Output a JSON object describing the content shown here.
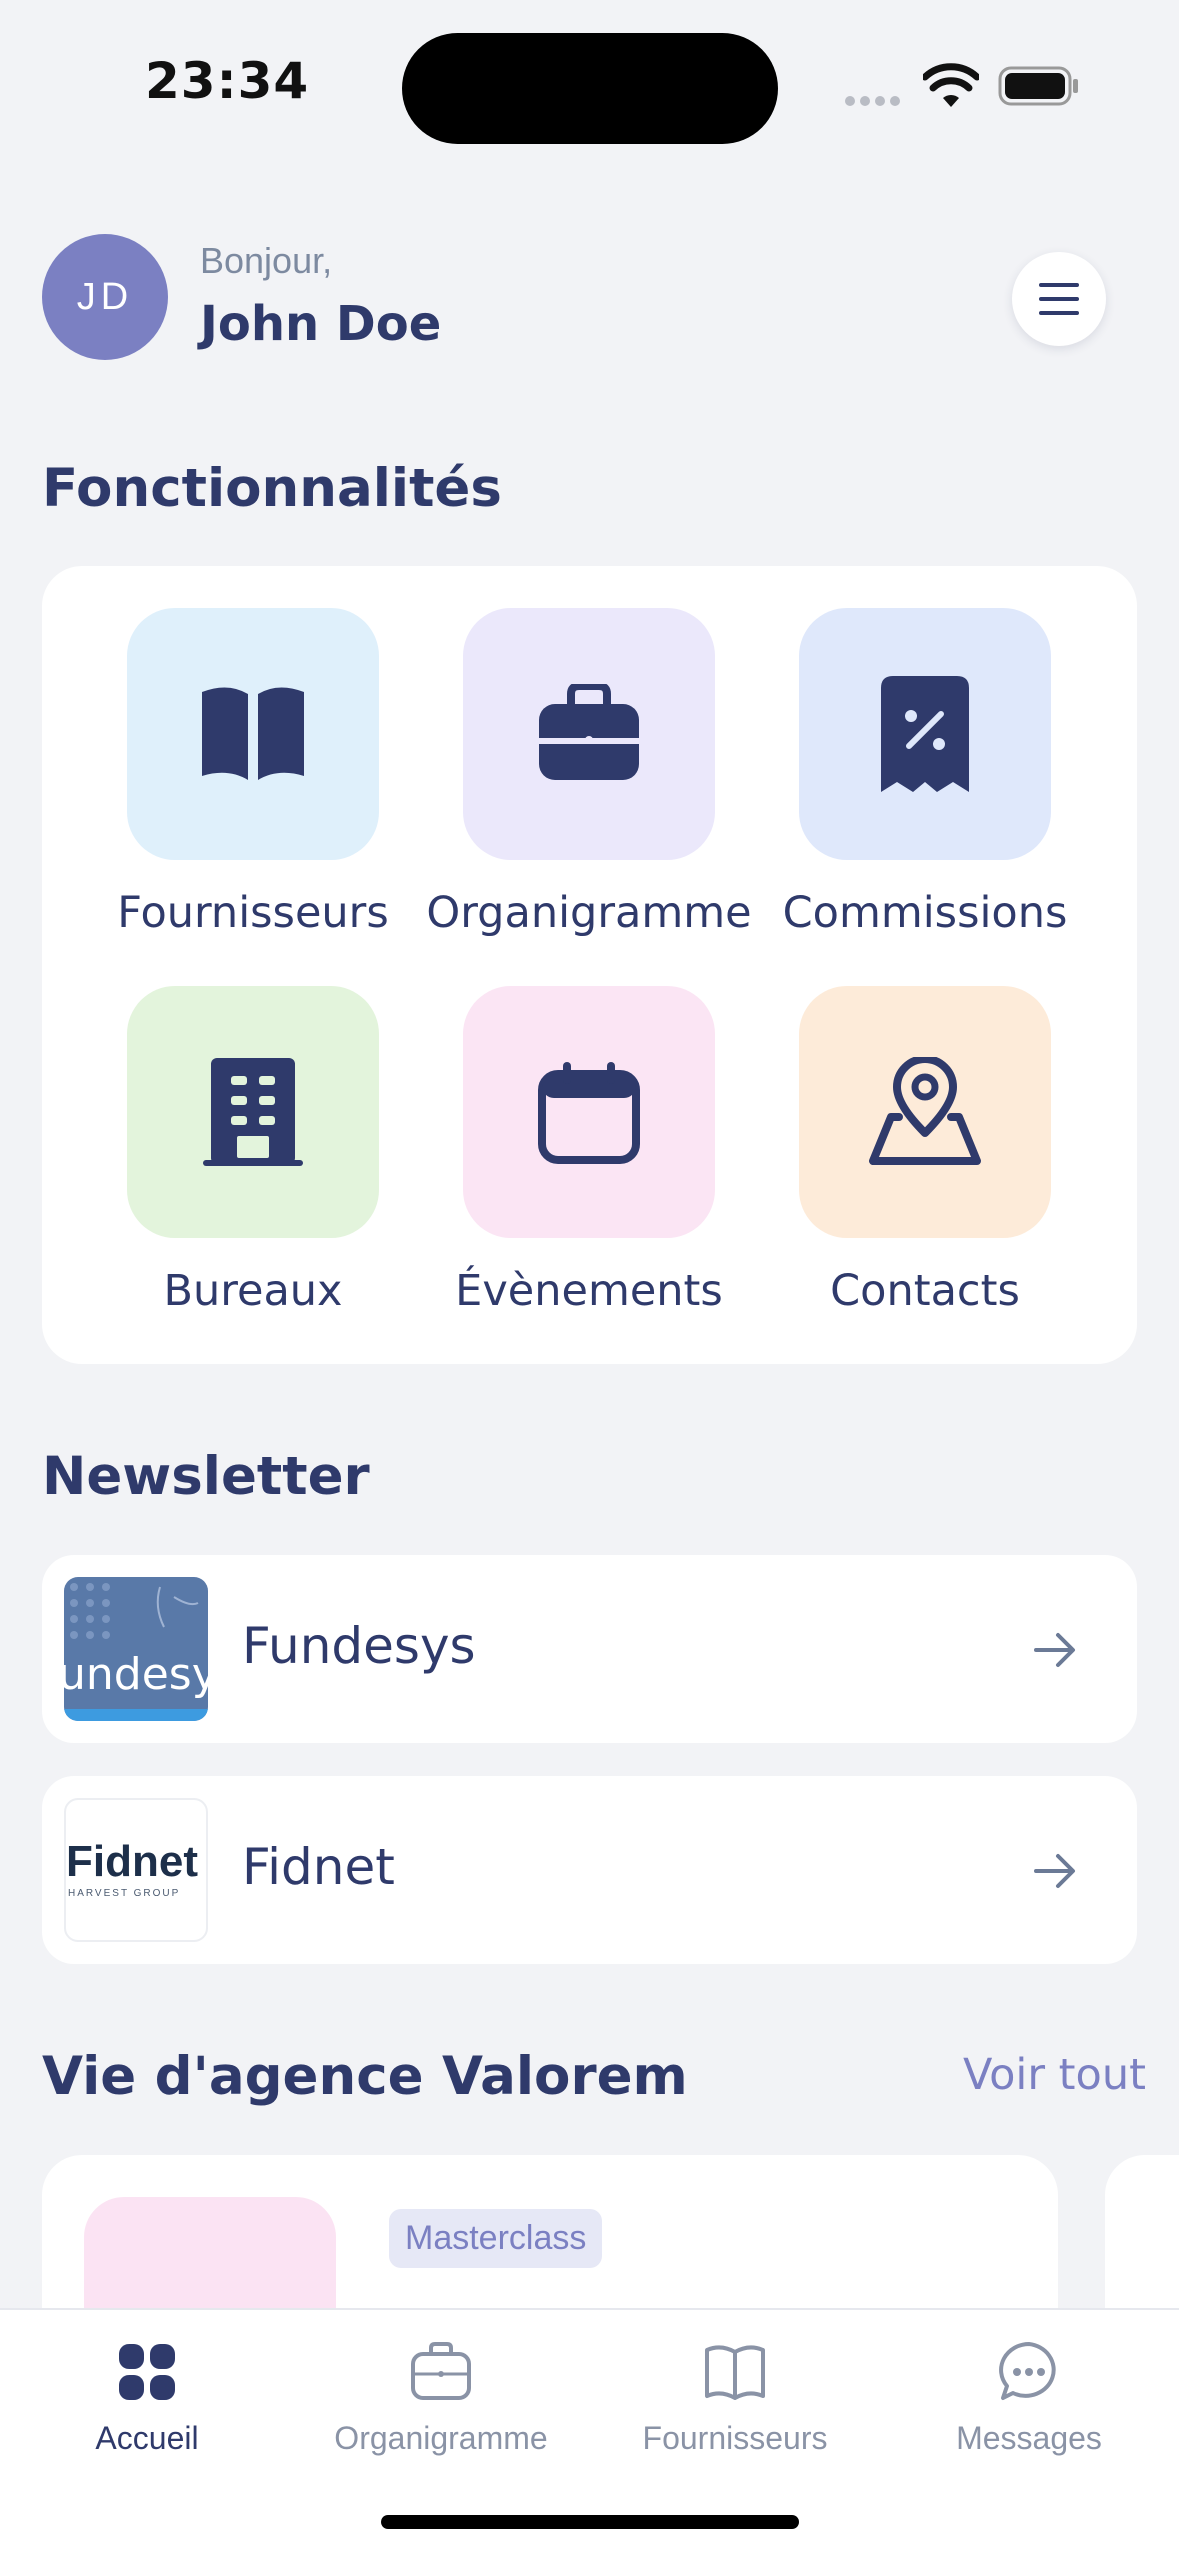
{
  "status_bar": {
    "time": "23:34"
  },
  "header": {
    "avatar_initials": "JD",
    "greeting": "Bonjour,",
    "name": "John Doe"
  },
  "features": {
    "title": "Fonctionnalités",
    "items": [
      {
        "label": "Fournisseurs",
        "icon": "book-icon",
        "bg": "#dff0fb"
      },
      {
        "label": "Organigramme",
        "icon": "briefcase-icon",
        "bg": "#ebe8fb"
      },
      {
        "label": "Commissions",
        "icon": "receipt-percent-icon",
        "bg": "#dfe8fb"
      },
      {
        "label": "Bureaux",
        "icon": "building-icon",
        "bg": "#e3f4dc"
      },
      {
        "label": "Évènements",
        "icon": "calendar-icon",
        "bg": "#fbe5f4"
      },
      {
        "label": "Contacts",
        "icon": "map-pin-icon",
        "bg": "#fdebd9"
      }
    ]
  },
  "newsletter": {
    "title": "Newsletter",
    "items": [
      {
        "name": "Fundesys",
        "thumb_text": "undesy"
      },
      {
        "name": "Fidnet",
        "thumb_text": "Fidnet",
        "thumb_sub": "HARVEST GROUP"
      }
    ]
  },
  "agency": {
    "title": "Vie d'agence Valorem",
    "see_all": "Voir tout",
    "badge": "Masterclass"
  },
  "bottom_nav": [
    {
      "label": "Accueil",
      "icon": "grid-icon",
      "active": true
    },
    {
      "label": "Organigramme",
      "icon": "briefcase-icon"
    },
    {
      "label": "Fournisseurs",
      "icon": "book-icon"
    },
    {
      "label": "Messages",
      "icon": "chat-bubble-icon"
    }
  ],
  "colors": {
    "primary": "#2f3a6b",
    "accent": "#7b80c2",
    "background": "#f2f3f6"
  }
}
